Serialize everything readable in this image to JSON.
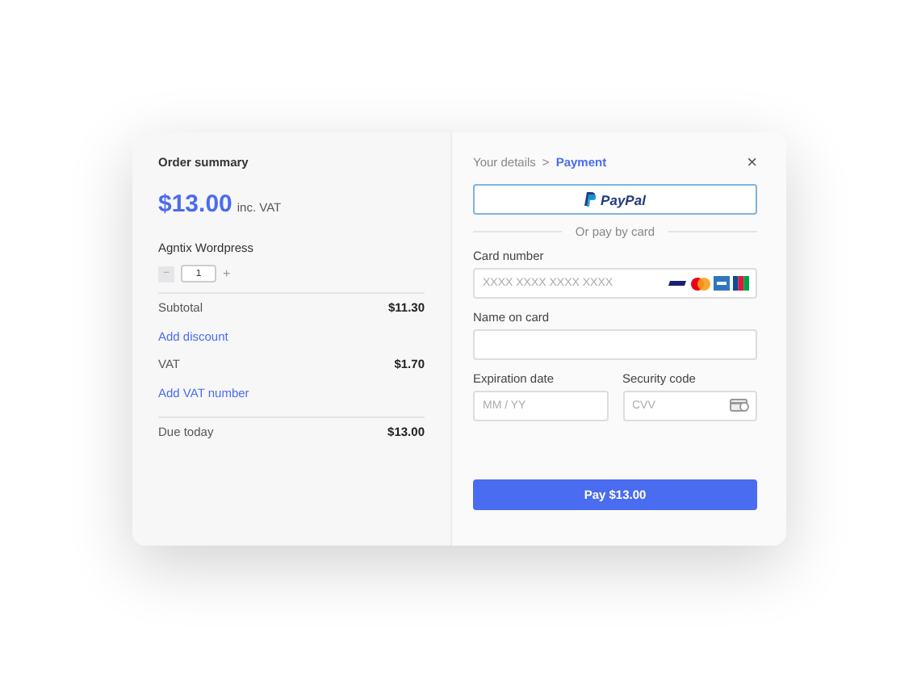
{
  "order_summary": {
    "title": "Order summary",
    "total": "$13.00",
    "total_note": "inc. VAT",
    "product": "Agntix Wordpress",
    "quantity": {
      "minus": "−",
      "value": "1",
      "plus": "+"
    },
    "lines": [
      {
        "kind": "amount",
        "label": "Subtotal",
        "value": "$11.30"
      },
      {
        "kind": "link",
        "label": "Add discount"
      },
      {
        "kind": "amount",
        "label": "VAT",
        "value": "$1.70"
      },
      {
        "kind": "link",
        "label": "Add VAT number"
      },
      {
        "kind": "total",
        "label": "Due today",
        "value": "$13.00"
      }
    ]
  },
  "payment": {
    "breadcrumb": [
      {
        "label": "Your details",
        "selected": false
      },
      {
        "label": "Payment",
        "selected": true
      }
    ],
    "separator": ">",
    "close": "×",
    "paypal": "PayPal",
    "divider_text": "Or pay by card",
    "fields": [
      {
        "kind": "card",
        "label": "Card number",
        "placeholder": "XXXX XXXX XXXX XXXX"
      },
      {
        "kind": "text",
        "label": "Name on card"
      },
      {
        "kind": "half",
        "label": "Expiration date",
        "placeholder": "MM / YY"
      },
      {
        "kind": "cvv",
        "label": "Security code",
        "placeholder": "CVV"
      }
    ],
    "pay_button": "Pay $13.00"
  }
}
